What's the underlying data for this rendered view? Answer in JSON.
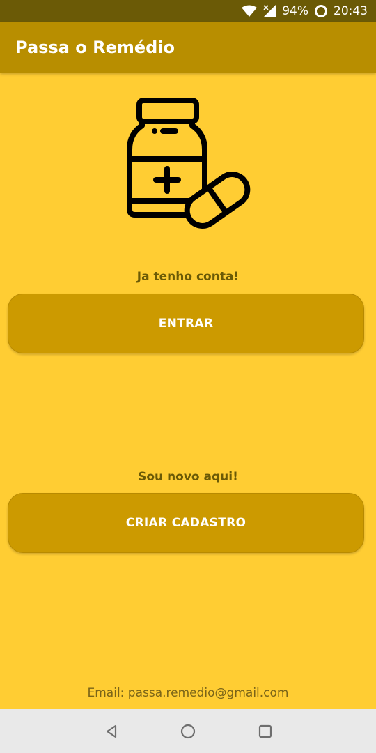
{
  "status_bar": {
    "battery_percent": "94%",
    "time": "20:43",
    "icons": [
      "wifi-icon",
      "cell-signal-icon",
      "battery-icon"
    ]
  },
  "app_bar": {
    "title": "Passa o Remédio"
  },
  "hero": {
    "icon": "medicine-bottle-pill-icon"
  },
  "login_section": {
    "label": "Ja tenho conta!",
    "button_label": "ENTRAR"
  },
  "signup_section": {
    "label": "Sou novo aqui!",
    "button_label": "CRIAR CADASTRO"
  },
  "footer": {
    "email_text": "Email: passa.remedio@gmail.com"
  },
  "nav_bar": {
    "icons": [
      "back-icon",
      "home-icon",
      "recent-apps-icon"
    ]
  },
  "colors": {
    "background": "#ffcd33",
    "app_bar": "#b88e00",
    "status_bar": "#6b5a06",
    "button": "#cc9a00",
    "label_text": "#6b5a06"
  }
}
